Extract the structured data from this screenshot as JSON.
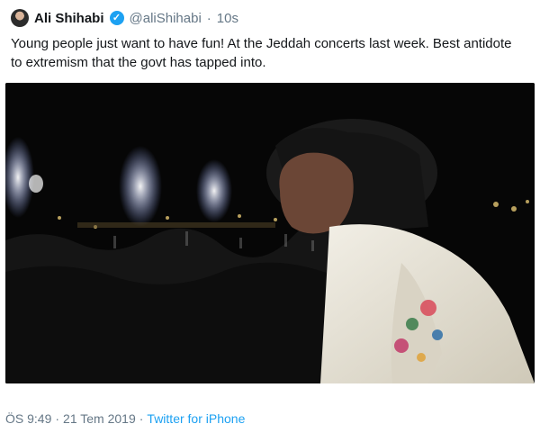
{
  "tweet": {
    "display_name": "Ali Shihabi",
    "handle": "@aliShihabi",
    "separator": "·",
    "time_ago": "10s",
    "text": "Young people just want to have fun! At the Jeddah concerts last week. Best antidote to extremism that the govt has tapped into."
  },
  "meta": {
    "time": "ÖS 9:49",
    "separator": "·",
    "date": "21 Tem 2019",
    "separator2": "·",
    "source": "Twitter for iPhone"
  },
  "colors": {
    "link": "#1da1f2",
    "muted": "#657786",
    "text": "#14171a"
  },
  "icons": {
    "verified": "verified-badge-icon",
    "avatar": "avatar"
  }
}
